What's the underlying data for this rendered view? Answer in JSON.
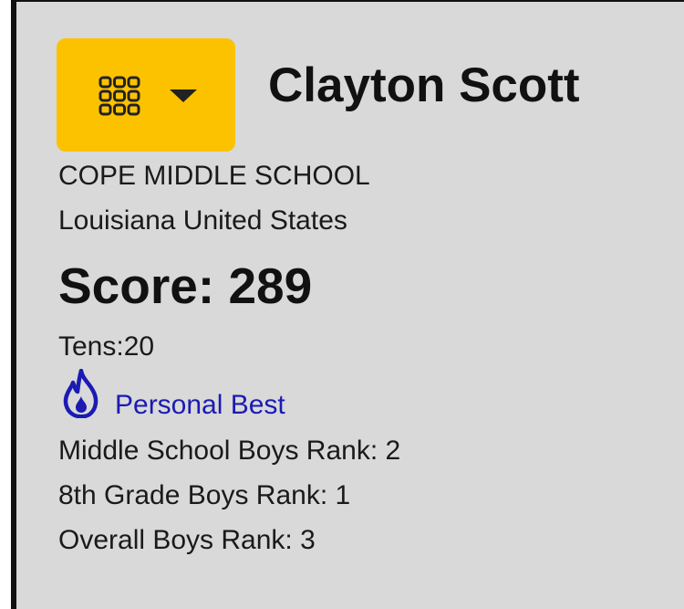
{
  "header": {
    "menu_button_icon": "grid-icon",
    "menu_caret_icon": "caret-down-icon",
    "accent_color": "#fcc200",
    "name": "Clayton Scott"
  },
  "profile": {
    "school": "COPE MIDDLE SCHOOL",
    "location": "Louisiana United States",
    "score_label": "Score: 289",
    "tens_label": "Tens:20",
    "personal_best_icon": "flame-icon",
    "personal_best_label": "Personal Best",
    "personal_best_color": "#1b1bb3",
    "ranks": [
      "Middle School Boys Rank: 2",
      "8th Grade Boys Rank: 1",
      "Overall Boys Rank: 3"
    ]
  }
}
